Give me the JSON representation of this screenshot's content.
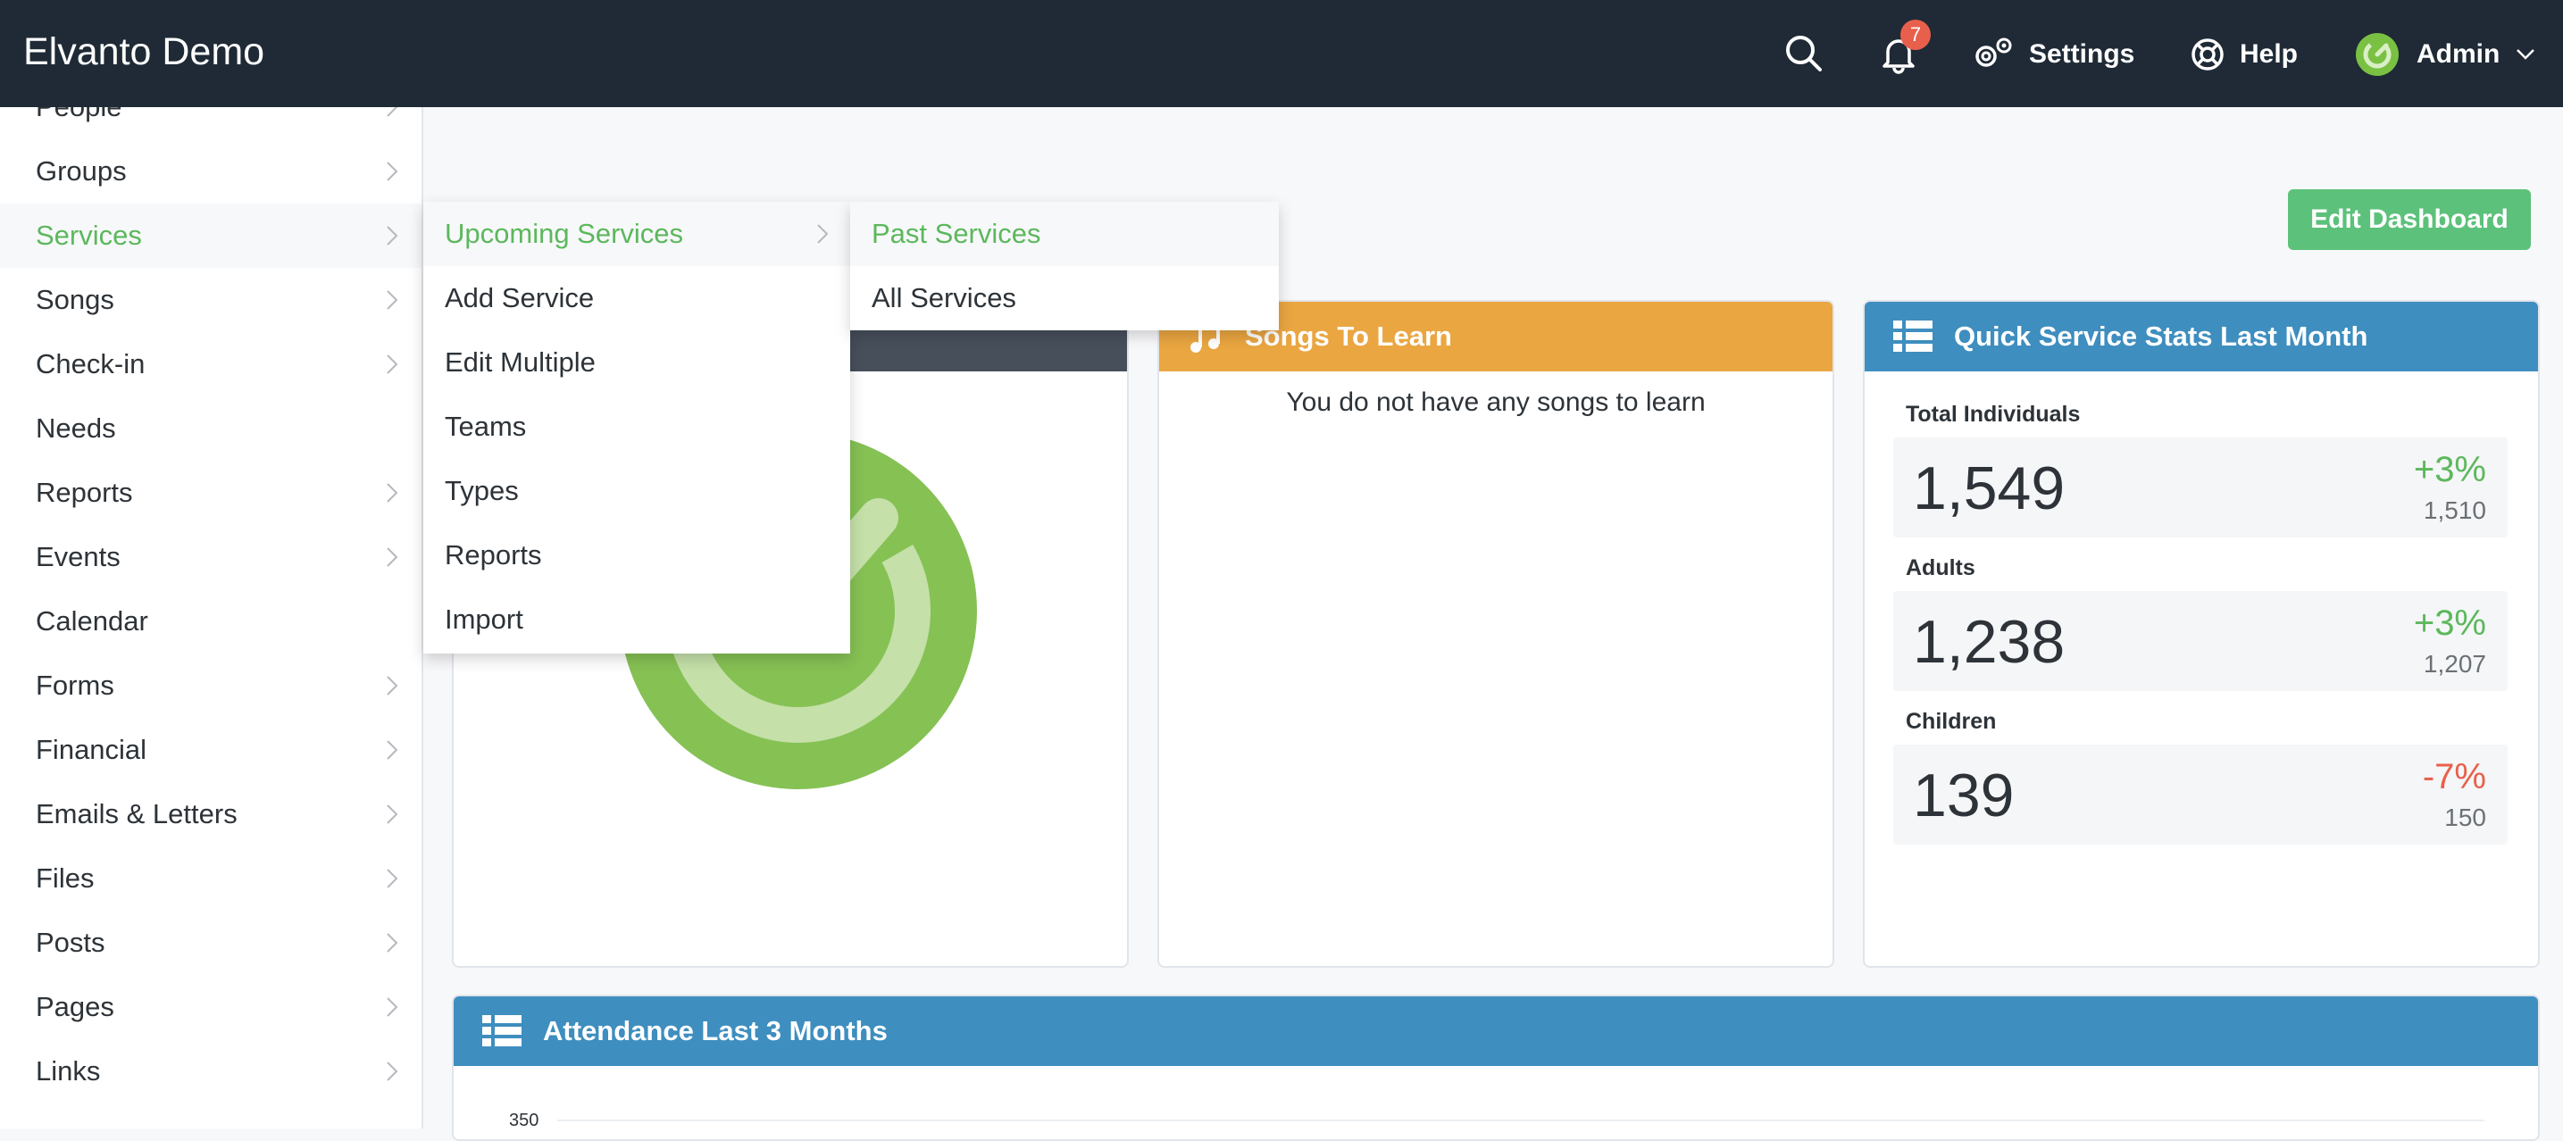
{
  "topbar": {
    "brand": "Elvanto Demo",
    "notifications_count": "7",
    "settings_label": "Settings",
    "help_label": "Help",
    "admin_label": "Admin"
  },
  "sidebar": {
    "items": [
      {
        "label": "People"
      },
      {
        "label": "Groups"
      },
      {
        "label": "Services"
      },
      {
        "label": "Songs"
      },
      {
        "label": "Check-in"
      },
      {
        "label": "Needs"
      },
      {
        "label": "Reports"
      },
      {
        "label": "Events"
      },
      {
        "label": "Calendar"
      },
      {
        "label": "Forms"
      },
      {
        "label": "Financial"
      },
      {
        "label": "Emails & Letters"
      },
      {
        "label": "Files"
      },
      {
        "label": "Posts"
      },
      {
        "label": "Pages"
      },
      {
        "label": "Links"
      }
    ]
  },
  "services_menu": {
    "items": [
      {
        "label": "Upcoming Services"
      },
      {
        "label": "Add Service"
      },
      {
        "label": "Edit Multiple"
      },
      {
        "label": "Teams"
      },
      {
        "label": "Types"
      },
      {
        "label": "Reports"
      },
      {
        "label": "Import"
      }
    ]
  },
  "upcoming_submenu": {
    "items": [
      {
        "label": "Past Services"
      },
      {
        "label": "All Services"
      }
    ]
  },
  "dashboard": {
    "edit_button": "Edit Dashboard",
    "songs": {
      "title": "Songs To Learn",
      "empty_text": "You do not have any songs to learn"
    },
    "stats": {
      "title": "Quick Service Stats Last Month",
      "rows": [
        {
          "label": "Total Individuals",
          "value": "1,549",
          "change": "+3%",
          "previous": "1,510"
        },
        {
          "label": "Adults",
          "value": "1,238",
          "change": "+3%",
          "previous": "1,207"
        },
        {
          "label": "Children",
          "value": "139",
          "change": "-7%",
          "previous": "150"
        }
      ]
    },
    "attendance": {
      "title": "Attendance Last 3 Months",
      "y_tick_top": "350"
    }
  },
  "colors": {
    "topbar": "#1f2a36",
    "accent_green": "#5cb85c",
    "songs_header": "#eaa641",
    "stats_header": "#3e8ebf",
    "negative": "#e8604c"
  }
}
